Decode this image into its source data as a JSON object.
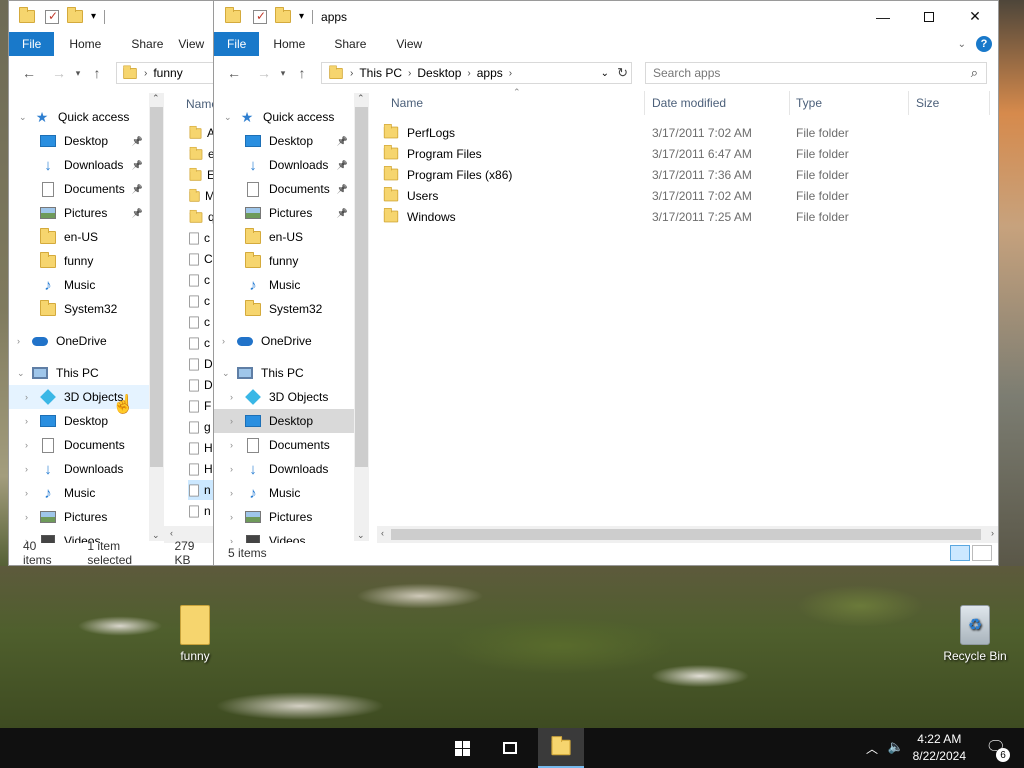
{
  "back_window": {
    "ribbon_tabs": [
      "File",
      "Home",
      "Share",
      "View"
    ],
    "address_folder": "funny",
    "column_name": "Name",
    "nav_items": [
      "Quick access",
      "Desktop",
      "Downloads",
      "Documents",
      "Pictures",
      "en-US",
      "funny",
      "Music",
      "System32",
      "OneDrive",
      "This PC",
      "3D Objects",
      "Desktop",
      "Documents",
      "Downloads",
      "Music",
      "Pictures",
      "Videos"
    ],
    "file_initials": [
      "A",
      "e",
      "E",
      "M",
      "q",
      "c",
      "C",
      "c",
      "c",
      "c",
      "c",
      "D",
      "D",
      "F",
      "g",
      "H",
      "H",
      "n",
      "n"
    ],
    "status_items": "40 items",
    "status_selected": "1 item selected",
    "status_size": "279 KB"
  },
  "front_window": {
    "title": "apps",
    "ribbon_tabs": [
      "File",
      "Home",
      "Share",
      "View"
    ],
    "breadcrumb": [
      "This PC",
      "Desktop",
      "apps"
    ],
    "search_placeholder": "Search apps",
    "columns": {
      "name": "Name",
      "date": "Date modified",
      "type": "Type",
      "size": "Size"
    },
    "files": [
      {
        "name": "PerfLogs",
        "date": "3/17/2011 7:02 AM",
        "type": "File folder"
      },
      {
        "name": "Program Files",
        "date": "3/17/2011 6:47 AM",
        "type": "File folder"
      },
      {
        "name": "Program Files (x86)",
        "date": "3/17/2011 7:36 AM",
        "type": "File folder"
      },
      {
        "name": "Users",
        "date": "3/17/2011 7:02 AM",
        "type": "File folder"
      },
      {
        "name": "Windows",
        "date": "3/17/2011 7:25 AM",
        "type": "File folder"
      }
    ],
    "nav_items": [
      "Quick access",
      "Desktop",
      "Downloads",
      "Documents",
      "Pictures",
      "en-US",
      "funny",
      "Music",
      "System32",
      "OneDrive",
      "This PC",
      "3D Objects",
      "Desktop",
      "Documents",
      "Downloads",
      "Music",
      "Pictures",
      "Videos"
    ],
    "status_items": "5 items"
  },
  "desktop": {
    "icons": [
      {
        "label": "funny"
      },
      {
        "label": "Recycle Bin"
      }
    ]
  },
  "taskbar": {
    "time": "4:22 AM",
    "date": "8/22/2024",
    "notification_count": "6"
  },
  "colors": {
    "accent": "#1979ca",
    "folder": "#f6d56e",
    "selection": "#d9d9d9"
  }
}
